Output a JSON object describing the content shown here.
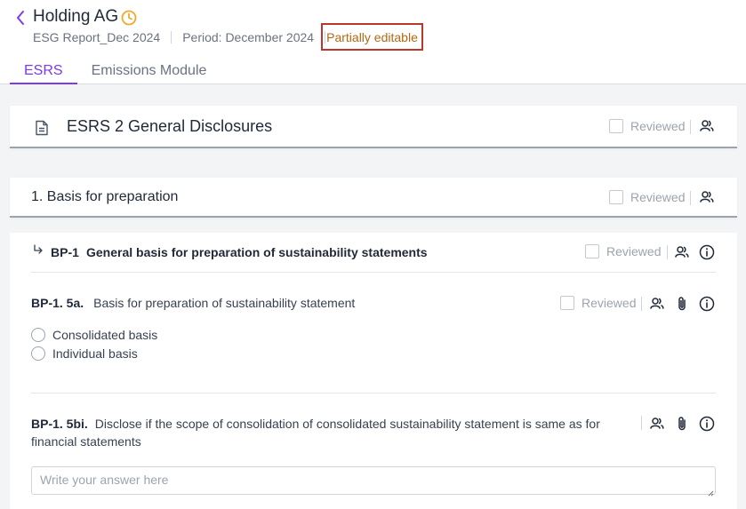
{
  "header": {
    "title": "Holding AG",
    "report": "ESG Report_Dec 2024",
    "period": "Period: December 2024",
    "status": "Partially editable"
  },
  "tabs": [
    {
      "label": "ESRS",
      "active": true
    },
    {
      "label": "Emissions Module",
      "active": false
    }
  ],
  "section": {
    "title": "ESRS 2 General Disclosures",
    "reviewed_label": "Reviewed"
  },
  "subsection": {
    "title": "1. Basis for preparation",
    "reviewed_label": "Reviewed"
  },
  "disclosure": {
    "code": "BP-1",
    "title": "General basis for preparation of sustainability statements",
    "reviewed_label": "Reviewed",
    "questions": [
      {
        "code": "BP-1. 5a.",
        "text": "Basis for preparation of sustainability statement",
        "reviewed_label": "Reviewed",
        "options": [
          "Consolidated basis",
          "Individual basis"
        ]
      },
      {
        "code": "BP-1. 5bi.",
        "text": "Disclose if the scope of consolidation of consolidated sustainability statement is same as for financial statements",
        "placeholder": "Write your answer here"
      }
    ]
  },
  "colors": {
    "accent": "#7c3aed",
    "status_border": "#b9382b",
    "status_text": "#b16a12",
    "clock": "#f0a92b"
  },
  "icons": [
    "back-chevron-icon",
    "clock-icon",
    "document-icon",
    "users-icon",
    "paperclip-icon",
    "info-icon",
    "subitem-arrow-icon"
  ]
}
